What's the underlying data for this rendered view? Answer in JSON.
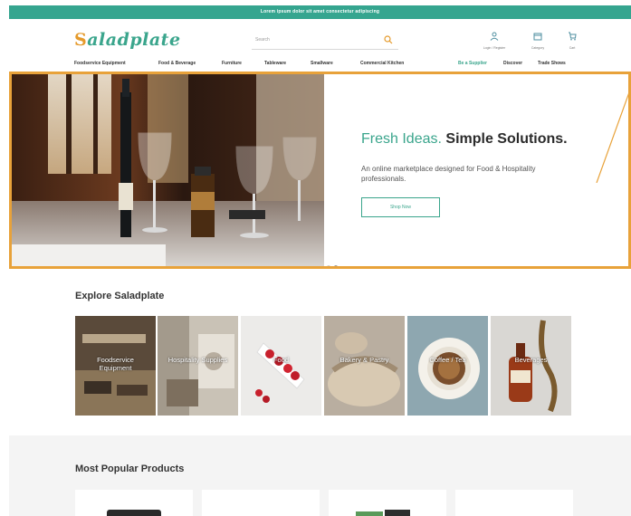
{
  "announcement": "Lorem ipsum dolor sit amet consectetur adipiscing",
  "logo": "Saladplate",
  "logo_mark": "S",
  "logo_rest": "aladplate",
  "search": {
    "placeholder": "Search"
  },
  "header_icons": [
    {
      "name": "account",
      "label": "Login / Register"
    },
    {
      "name": "category",
      "label": "Category"
    },
    {
      "name": "cart",
      "label": "Cart"
    }
  ],
  "nav": {
    "left": [
      "Foodservice Equipment",
      "Food & Beverage",
      "Furniture",
      "Tableware",
      "Smallware",
      "Commercial Kitchen"
    ],
    "right": [
      "Be a Supplier",
      "Discover",
      "Trade Shows"
    ]
  },
  "hero": {
    "title_accent": "Fresh Ideas.",
    "title_main": "Simple Solutions.",
    "subtitle": "An online marketplace designed for Food & Hospitality professionals.",
    "button": "Shop Now",
    "slides": 2,
    "active_slide": 1
  },
  "explore": {
    "title": "Explore Saladplate",
    "tiles": [
      {
        "label": "Foodservice Equipment"
      },
      {
        "label": "Hospitality Supplies"
      },
      {
        "label": "Food"
      },
      {
        "label": "Bakery & Pastry"
      },
      {
        "label": "Coffee / Tea"
      },
      {
        "label": "Beverages"
      }
    ]
  },
  "popular": {
    "title": "Most Popular Products"
  },
  "colors": {
    "brand": "#3aa58c",
    "accent": "#e8a23a",
    "announce": "#35a58f"
  }
}
